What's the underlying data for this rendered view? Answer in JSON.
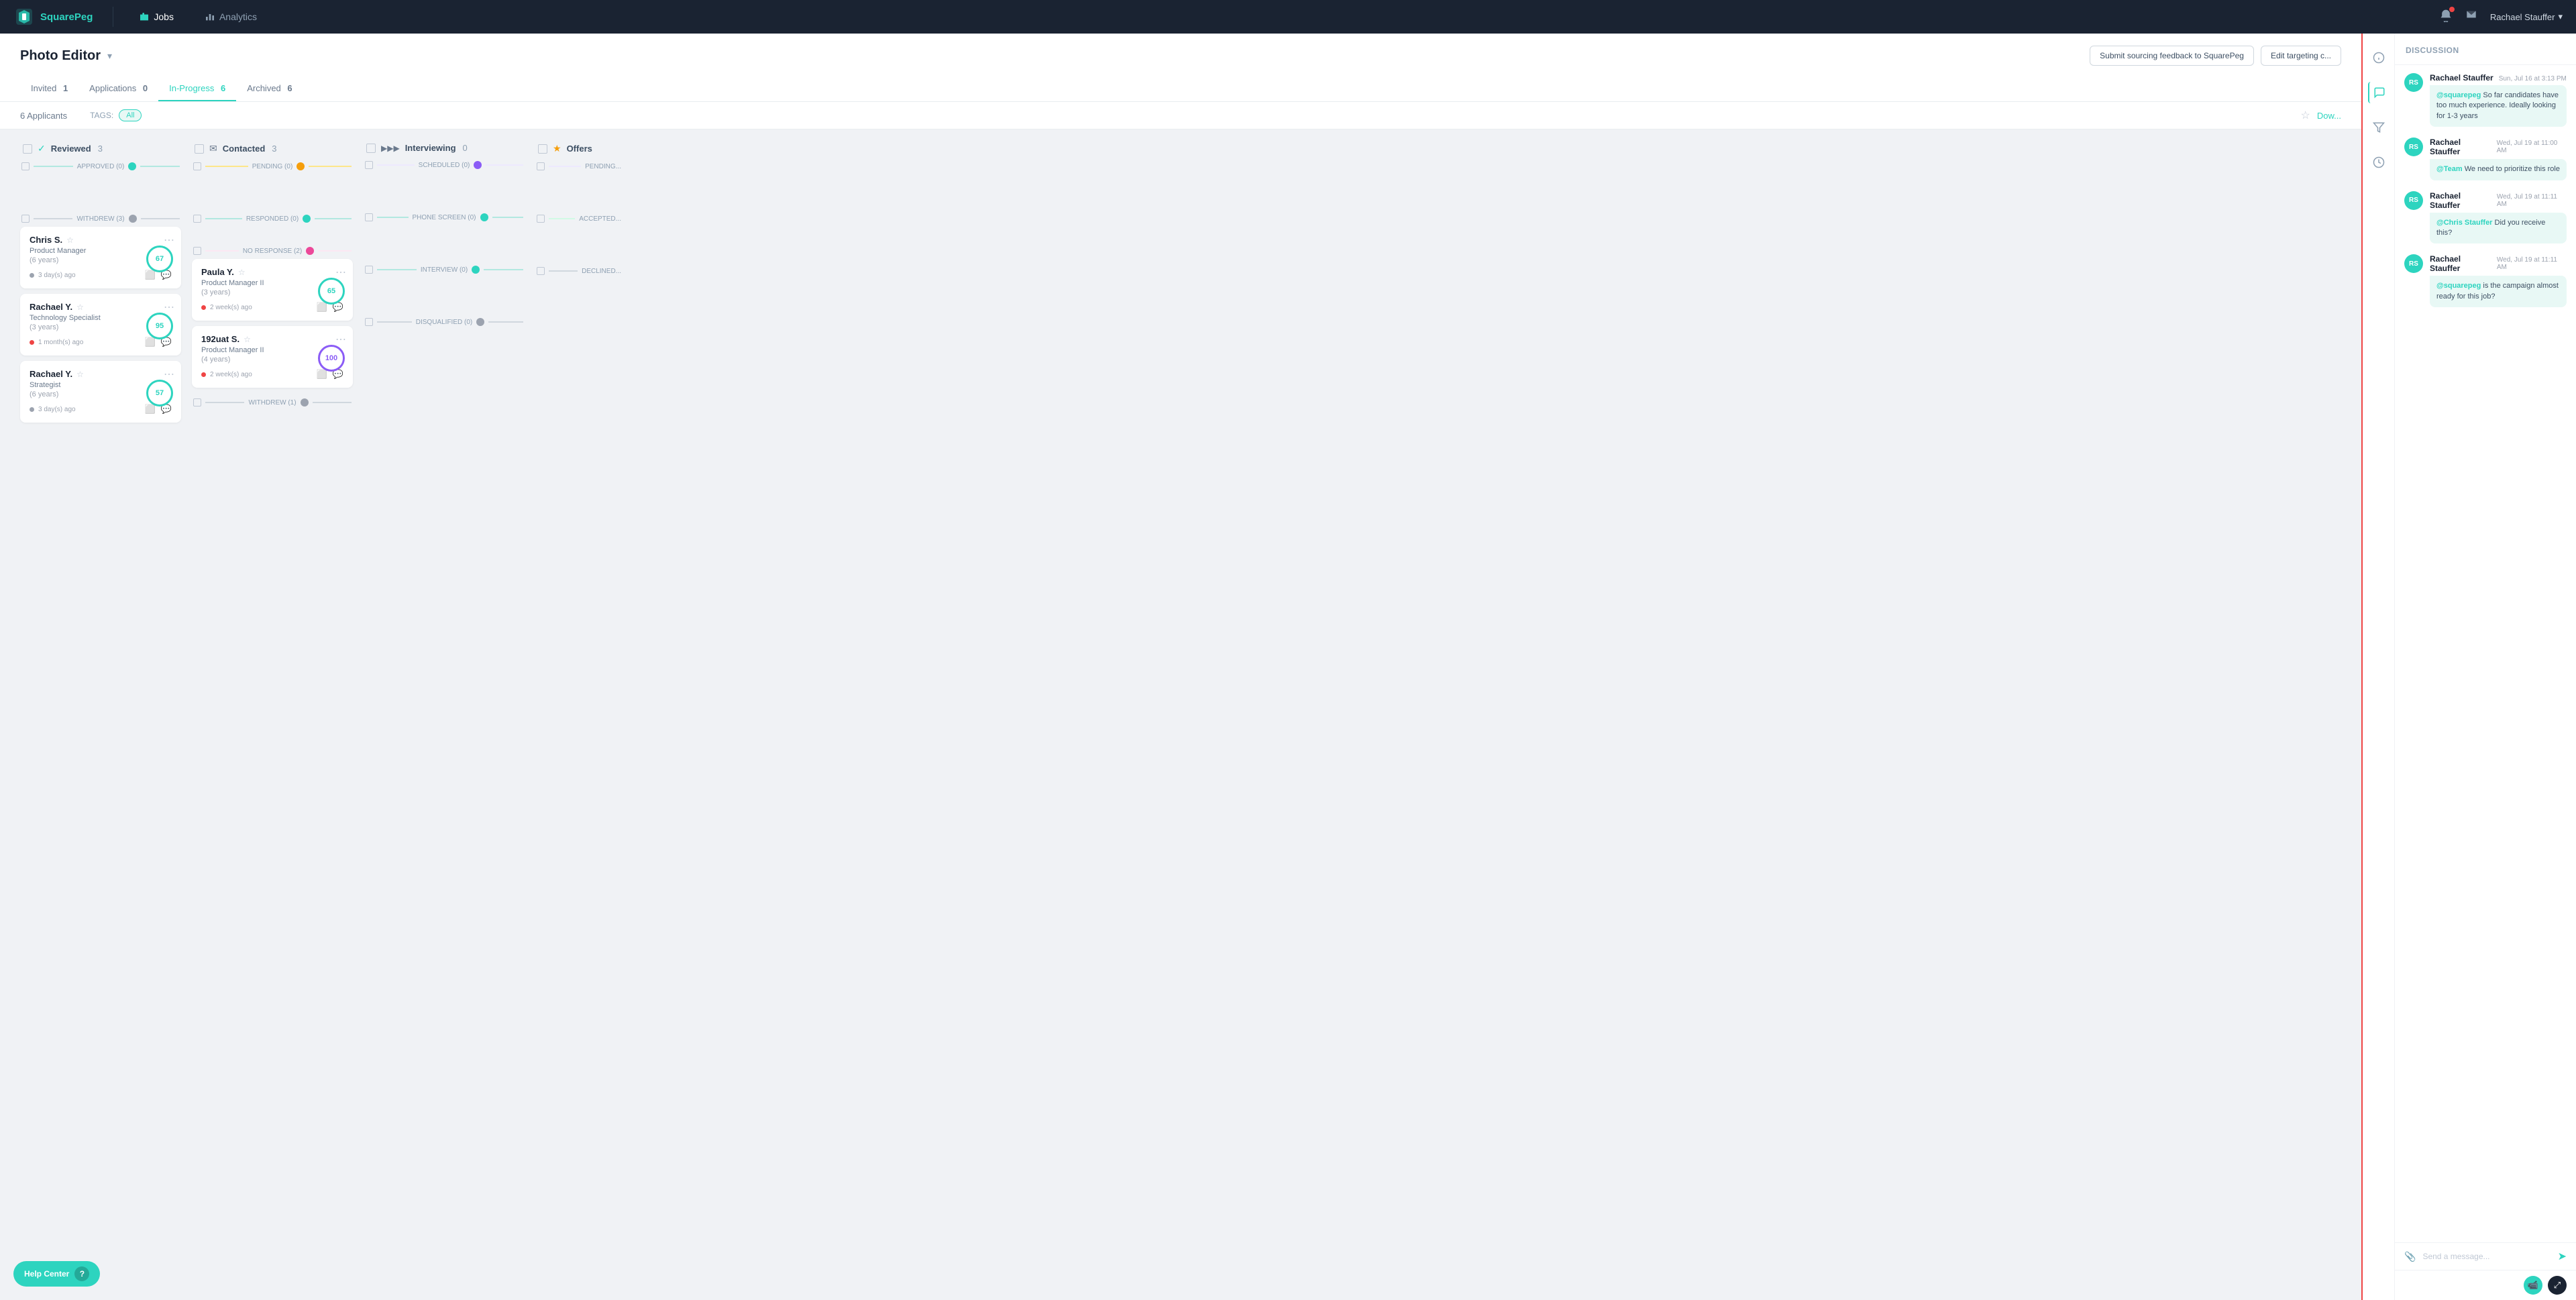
{
  "app": {
    "name": "SquarePeg",
    "logo_text": "SquarePeg"
  },
  "nav": {
    "items": [
      {
        "id": "jobs",
        "label": "Jobs",
        "active": true
      },
      {
        "id": "analytics",
        "label": "Analytics",
        "active": false
      }
    ],
    "user": "Rachael Stauffer"
  },
  "job": {
    "title": "Photo Editor",
    "actions": {
      "submit_feedback": "Submit sourcing feedback to SquarePeg",
      "edit_targeting": "Edit targeting c..."
    }
  },
  "tabs": [
    {
      "id": "invited",
      "label": "Invited",
      "count": "1",
      "active": false
    },
    {
      "id": "applications",
      "label": "Applications",
      "count": "0",
      "active": false
    },
    {
      "id": "in-progress",
      "label": "In-Progress",
      "count": "6",
      "active": true
    },
    {
      "id": "archived",
      "label": "Archived",
      "count": "6",
      "active": false
    }
  ],
  "toolbar": {
    "applicants_count": "6 Applicants",
    "tags_label": "TAGS:",
    "tags_all": "All",
    "download_label": "Dow..."
  },
  "kanban": {
    "columns": [
      {
        "id": "reviewed",
        "icon": "✓",
        "title": "Reviewed",
        "count": "3",
        "stages": [
          {
            "label": "APPROVED (0)",
            "dot_color": "teal",
            "line_color": "#d0e8e4"
          },
          {
            "label": "WITHDREW (3)",
            "dot_color": "gray",
            "line_color": "#d0d7de"
          }
        ],
        "cards": [
          {
            "name": "Chris S.",
            "title": "Product Manager",
            "years": "(6 years)",
            "ago": "3 day(s) ago",
            "dot_color": "gray",
            "score": "67",
            "score_class": "teal"
          },
          {
            "name": "Rachael Y.",
            "title": "Technology Specialist",
            "years": "(3 years)",
            "ago": "1 month(s) ago",
            "dot_color": "red",
            "score": "95",
            "score_class": "multi"
          },
          {
            "name": "Rachael Y.",
            "title": "Strategist",
            "years": "(6 years)",
            "ago": "3 day(s) ago",
            "dot_color": "gray",
            "score": "57",
            "score_class": "teal"
          }
        ]
      },
      {
        "id": "contacted",
        "icon": "✉",
        "title": "Contacted",
        "count": "3",
        "stages": [
          {
            "label": "PENDING (0)",
            "dot_color": "yellow",
            "line_color": "#fde68a"
          },
          {
            "label": "RESPONDED (0)",
            "dot_color": "teal",
            "line_color": "#d0e8e4"
          },
          {
            "label": "NO RESPONSE (2)",
            "dot_color": "pink",
            "line_color": "#fce7f3"
          }
        ],
        "cards": [
          {
            "name": "Paula Y.",
            "title": "Product Manager II",
            "years": "(3 years)",
            "ago": "2 week(s) ago",
            "dot_color": "red",
            "score": "65",
            "score_class": "teal"
          },
          {
            "name": "192uat S.",
            "title": "Product Manager II",
            "years": "(4 years)",
            "ago": "2 week(s) ago",
            "dot_color": "red",
            "score": "100",
            "score_class": "purple"
          }
        ]
      },
      {
        "id": "interviewing",
        "icon": "▶",
        "title": "Interviewing",
        "count": "0",
        "stages": [
          {
            "label": "SCHEDULED (0)",
            "dot_color": "purple",
            "line_color": "#ede9fe"
          },
          {
            "label": "PHONE SCREEN (0)",
            "dot_color": "teal",
            "line_color": "#d0e8e4"
          },
          {
            "label": "INTERVIEW (0)",
            "dot_color": "teal",
            "line_color": "#d0e8e4"
          },
          {
            "label": "DISQUALIFIED (0)",
            "dot_color": "gray",
            "line_color": "#d0d7de"
          }
        ],
        "cards": []
      },
      {
        "id": "offers",
        "icon": "★",
        "title": "Offers",
        "count": "",
        "stages": [
          {
            "label": "PENDING...",
            "dot_color": "purple",
            "line_color": "#ede9fe"
          },
          {
            "label": "ACCEPTED...",
            "dot_color": "green",
            "line_color": "#d1fae5"
          },
          {
            "label": "DECLINED...",
            "dot_color": "gray",
            "line_color": "#d0d7de"
          }
        ],
        "cards": []
      }
    ]
  },
  "discussion": {
    "title": "DISCUSSION",
    "messages": [
      {
        "author": "Rachael Stauffer",
        "initials": "RS",
        "time": "Sun, Jul 16 at 3:13 PM",
        "text": "@squarepeg So far candidates have too much experience. Ideally looking for 1-3 years"
      },
      {
        "author": "Rachael Stauffer",
        "initials": "RS",
        "time": "Wed, Jul 19 at 11:00 AM",
        "text": "@Team We need to prioritize this role"
      },
      {
        "author": "Rachael Stauffer",
        "initials": "RS",
        "time": "Wed, Jul 19 at 11:11 AM",
        "text": "@Chris Stauffer Did you receive this?"
      },
      {
        "author": "Rachael Stauffer",
        "initials": "RS",
        "time": "Wed, Jul 19 at 11:11 AM",
        "text": "@squarepeg is the campaign almost ready for this job?"
      }
    ],
    "input_placeholder": "Send a message..."
  },
  "help_center": {
    "label": "Help Center"
  }
}
